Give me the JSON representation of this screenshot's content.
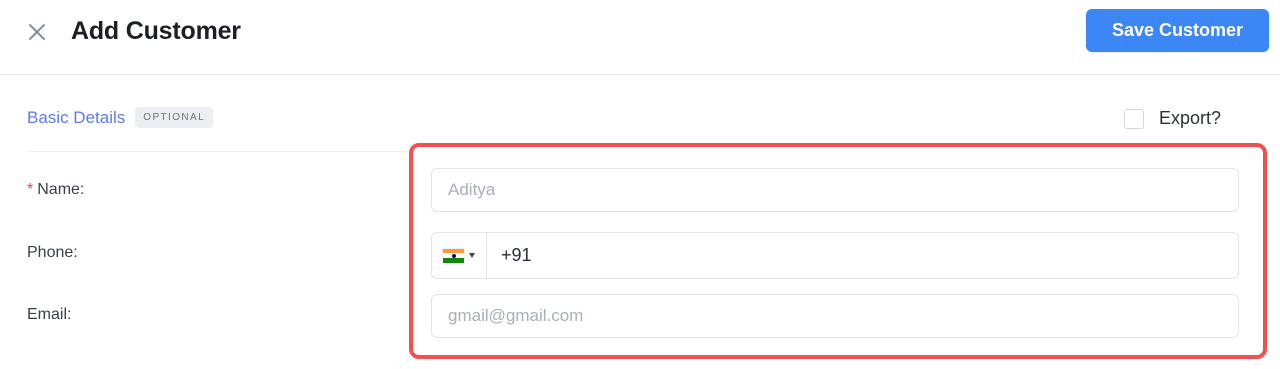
{
  "header": {
    "title": "Add Customer",
    "close_icon": "close-icon",
    "save_label": "Save Customer"
  },
  "section": {
    "title": "Basic Details",
    "badge": "OPTIONAL",
    "export_label": "Export?",
    "export_checked": false
  },
  "fields": {
    "name": {
      "label": "Name",
      "required_mark": "*",
      "colon": ":",
      "value": "",
      "placeholder": "Aditya"
    },
    "phone": {
      "label": "Phone",
      "colon": ":",
      "country_flag": "india-flag-icon",
      "value": "+91"
    },
    "email": {
      "label": "Email",
      "colon": ":",
      "value": "",
      "placeholder": "gmail@gmail.com"
    }
  },
  "colors": {
    "accent": "#3d86f6",
    "section_title": "#5a7cf0",
    "highlight_border": "#f05050",
    "required": "#e5484d"
  }
}
